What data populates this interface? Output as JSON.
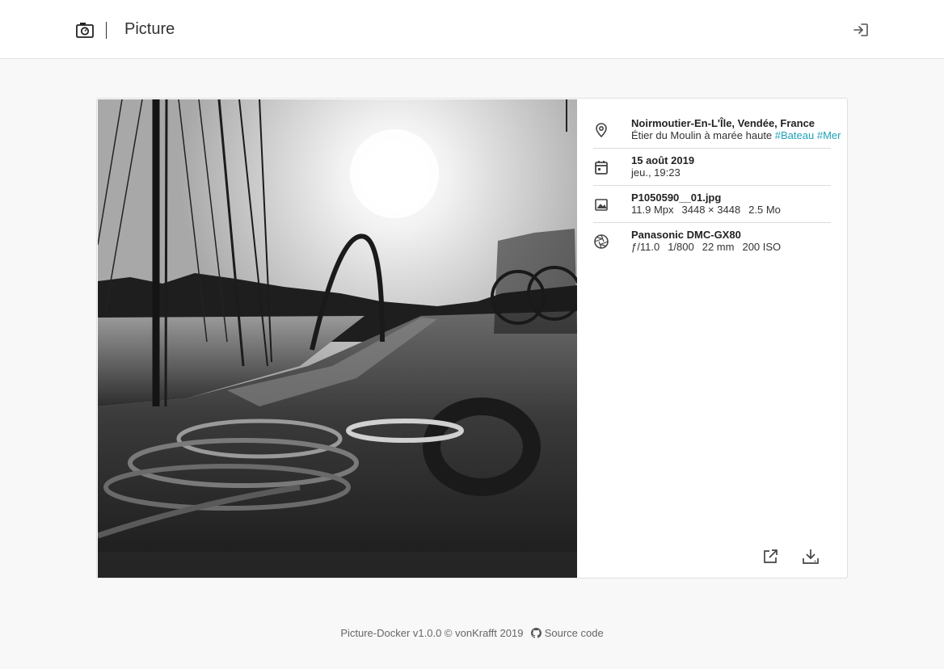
{
  "app": {
    "title": "Picture"
  },
  "header": {
    "logo_icon": "camera-icon",
    "login_icon": "sign-in-icon"
  },
  "photo": {
    "alt": "Black and white photo of a harbour quay with ropes, mooring ring, masts and bicycles against the sun"
  },
  "info": {
    "location": {
      "icon": "map-pin-icon",
      "place": "Noirmoutier-En-L'Île, Vendée, France",
      "caption": "Étier du Moulin à marée haute",
      "tags": [
        "#Bateau",
        "#Mer"
      ]
    },
    "date": {
      "icon": "calendar-icon",
      "day": "15 août 2019",
      "time": "jeu., 19:23"
    },
    "file": {
      "icon": "image-icon",
      "name": "P1050590__01.jpg",
      "megapixels": "11.9 Mpx",
      "dimensions": "3448 × 3448",
      "size": "2.5 Mo"
    },
    "camera": {
      "icon": "aperture-icon",
      "model": "Panasonic DMC-GX80",
      "aperture": "ƒ/11.0",
      "shutter": "1/800",
      "focal": "22 mm",
      "iso": "200 ISO"
    }
  },
  "actions": {
    "open_icon": "external-link-icon",
    "download_icon": "download-icon"
  },
  "footer": {
    "credit": "Picture-Docker v1.0.0 © vonKrafft 2019",
    "source_label": "Source code",
    "github_icon": "github-icon"
  },
  "colors": {
    "accent": "#1fa2b8",
    "background": "#f8f8f8"
  }
}
